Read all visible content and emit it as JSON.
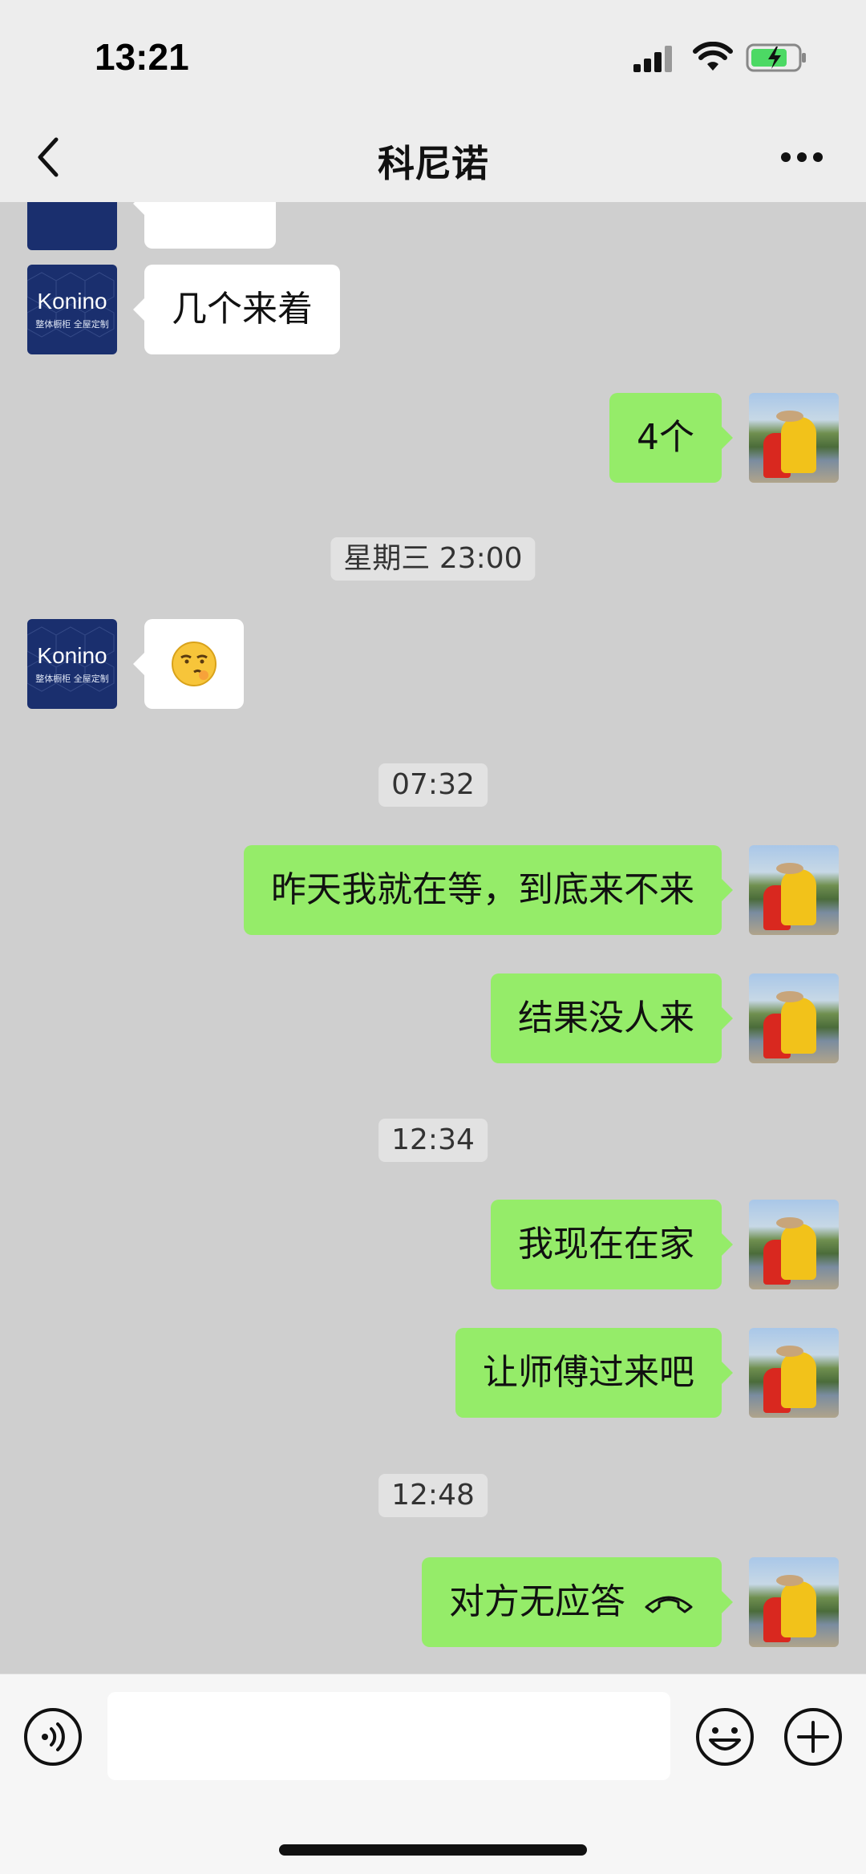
{
  "status_bar": {
    "time": "13:21"
  },
  "header": {
    "title": "科尼诺"
  },
  "contact": {
    "brand": "Konino",
    "brand_sub": "整体橱柜 全屋定制"
  },
  "messages": {
    "m1": "几个来着",
    "m2": "4个",
    "ts1": "星期三 23:00",
    "m3_emoji": "😏",
    "ts2": "07:32",
    "m4": "昨天我就在等，到底来不来",
    "m5": "结果没人来",
    "ts3": "12:34",
    "m6": "我现在在家",
    "m7": "让师傅过来吧",
    "ts4": "12:48",
    "m8": "对方无应答"
  },
  "colors": {
    "outgoing_bubble": "#95ec69",
    "incoming_bubble": "#ffffff",
    "chat_bg": "#cfcfcf",
    "brand_avatar": "#1a2f6e"
  },
  "icons": [
    "back-icon",
    "more-icon",
    "voice-icon",
    "emoji-icon",
    "plus-icon",
    "hangup-icon"
  ]
}
